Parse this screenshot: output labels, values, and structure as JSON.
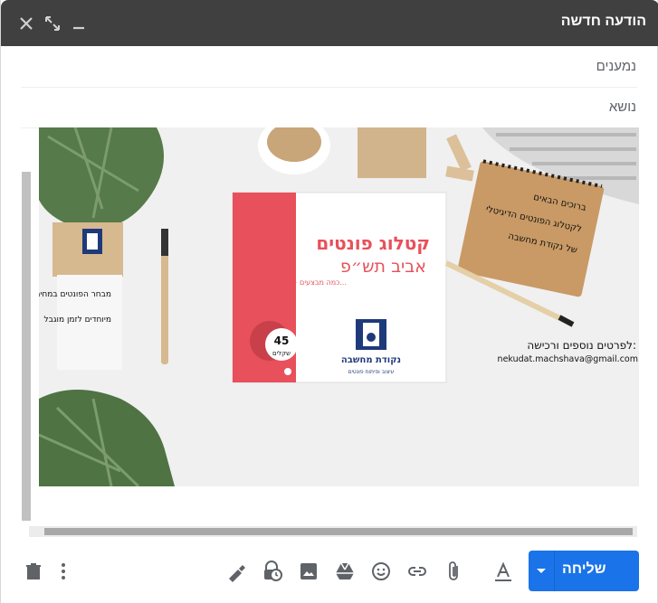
{
  "window": {
    "title": "הודעה חדשה"
  },
  "fields": {
    "to_label": "נמענים",
    "subject_label": "נושא"
  },
  "image": {
    "catalog_title": "קטלוג פונטים",
    "catalog_subtitle": "אביב תש״פ",
    "catalog_note": "+ כמה מבצעים...",
    "price_number": "45",
    "price_unit": "שקלים",
    "brand_name": "נקודת מחשבה",
    "brand_tagline": "עיצוב ופיתוח פונטים",
    "note_line1": "מבחר הפונטים במחירים",
    "note_line2": "מיוחדים לזמן מוגבל",
    "notebook_line1": "ברוכים הבאים",
    "notebook_line2": "לקטלוג הפונטים הדיגיטלי",
    "notebook_line3": "של נקודת מחשבה",
    "contact_label": "לפרטים נוספים ורכישה:",
    "email": "nekudat.machshava@gmail.com"
  },
  "toolbar": {
    "send_label": "שליחה"
  },
  "icons": [
    "close-icon",
    "expand-icon",
    "minimize-icon",
    "delete-icon",
    "more-options-icon",
    "signature-icon",
    "confidential-icon",
    "insert-photo-icon",
    "drive-icon",
    "emoji-icon",
    "link-icon",
    "attach-icon",
    "formatting-icon",
    "send-options-icon"
  ],
  "colors": {
    "titlebar": "#404040",
    "send": "#1a73e8",
    "catalog_red": "#e8505b",
    "brand_navy": "#1f3a7a"
  }
}
